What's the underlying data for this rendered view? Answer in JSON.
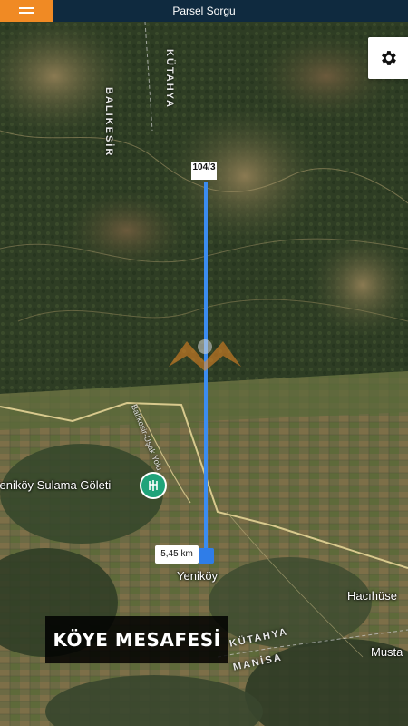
{
  "header": {
    "title": "Parsel Sorgu",
    "menu_icon": "hamburger-menu-icon",
    "accent_color": "#f08a24",
    "bar_color": "#0f2a3f"
  },
  "map": {
    "settings_icon": "gear-icon",
    "route_color": "#3b8cf0",
    "parcel_label": "104/3",
    "distance_label": "5,45 km",
    "places": {
      "yenikoy": "Yeniköy",
      "pond": "Yeniköy Sulama Göleti",
      "hacihuseyin": "Hacıhüse",
      "mustafa": "Musta"
    },
    "admin": {
      "balikesir": "BALIKESİR",
      "kutahya_top": "KÜTAHYA",
      "kutahya_bottom": "KÜTAHYA",
      "manisa": "MANİSA"
    },
    "road": "Balıkesir-Uşak Yolu",
    "pond_icon": "pond-icon"
  },
  "caption": {
    "text": "KÖYE MESAFESİ"
  }
}
